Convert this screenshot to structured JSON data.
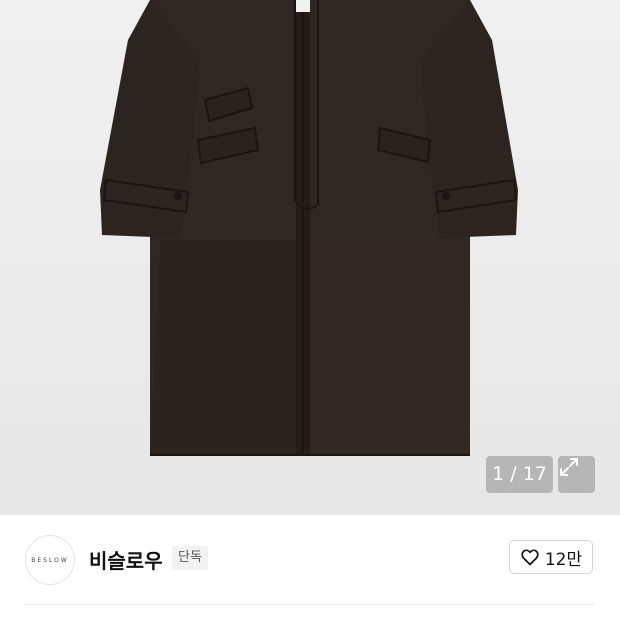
{
  "gallery": {
    "image_alt": "coat",
    "counter": "1 / 17",
    "expand_icon": "expand-icon"
  },
  "brand": {
    "logo_text": "BESLOW",
    "name": "비슬로우",
    "badge": "단독"
  },
  "like": {
    "icon": "heart-outline-icon",
    "count": "12만"
  }
}
